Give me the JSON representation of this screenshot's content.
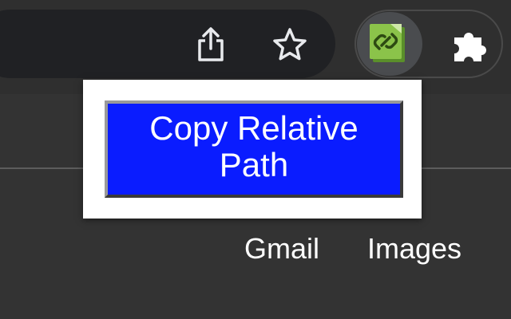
{
  "toolbar": {
    "share_icon": "share-icon",
    "bookmark_icon": "star-icon",
    "extension_icon": "link-clipboard-icon",
    "extensions_menu_icon": "puzzle-icon"
  },
  "popup": {
    "button_label": "Copy Relative Path",
    "button_color": "#0a1cff"
  },
  "page": {
    "links": [
      {
        "label": "Gmail"
      },
      {
        "label": "Images"
      }
    ]
  },
  "colors": {
    "background": "#333333",
    "omnibox": "#202124",
    "extension_green": "#8bc34a"
  }
}
